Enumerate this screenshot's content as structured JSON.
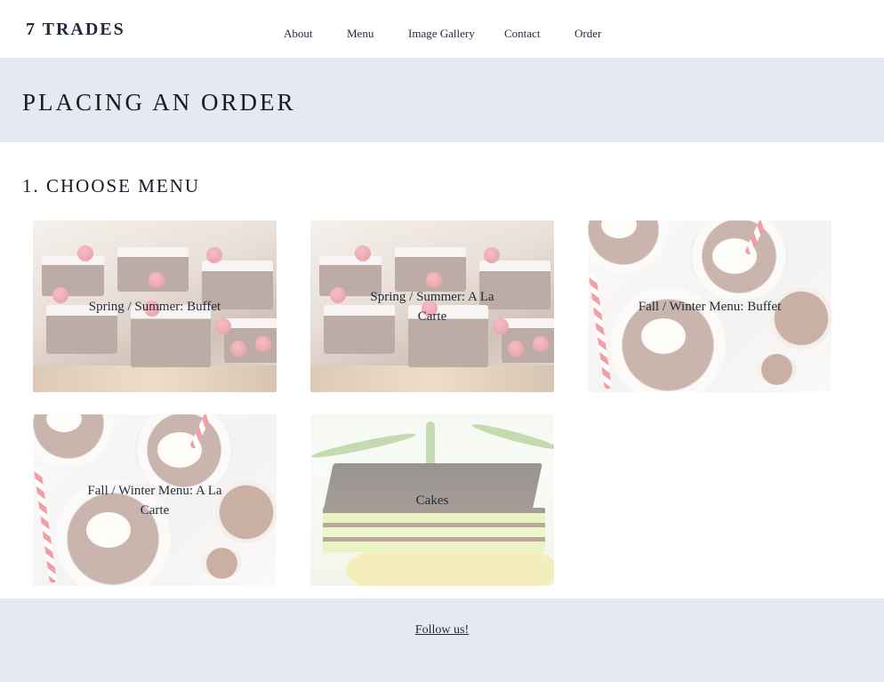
{
  "header": {
    "logo": "7 TRADES",
    "nav": [
      "About",
      "Menu",
      "Image Gallery",
      "Contact",
      "Order"
    ]
  },
  "banner": {
    "title": "PLACING AN ORDER"
  },
  "section": {
    "title": "1. CHOOSE MENU"
  },
  "cards": [
    {
      "label": "Spring / Summer: Buffet",
      "image": "brownies"
    },
    {
      "label": "Spring / Summer: A La Carte",
      "image": "brownies"
    },
    {
      "label": "Fall / Winter Menu: Buffet",
      "image": "hot-cocoa"
    },
    {
      "label": "Fall / Winter Menu: A La Carte",
      "image": "hot-cocoa"
    },
    {
      "label": "Cakes",
      "image": "layer-cake"
    }
  ],
  "footer": {
    "link": "Follow us!"
  },
  "colors": {
    "banner": "#e4e9f2",
    "text": "#1f2a3a"
  }
}
